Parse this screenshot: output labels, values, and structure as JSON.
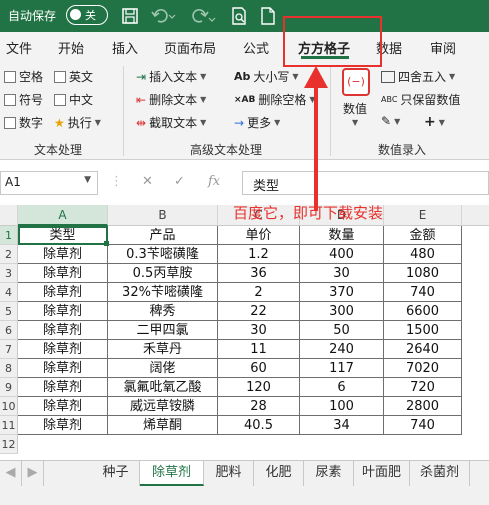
{
  "titlebar": {
    "autosave_label": "自动保存",
    "toggle_state": "关"
  },
  "tabs": [
    "文件",
    "开始",
    "插入",
    "页面布局",
    "公式",
    "方方格子",
    "数据",
    "审阅"
  ],
  "ribbon": {
    "text_group": {
      "items": [
        "空格",
        "英文",
        "符号",
        "中文",
        "数字",
        "执行"
      ],
      "title": "文本处理"
    },
    "advanced_group": {
      "items": [
        "插入文本",
        "删除文本",
        "截取文本",
        "大小写",
        "删除空格",
        "更多"
      ],
      "title": "高级文本处理"
    },
    "number_group": {
      "items": [
        "数值",
        "四舍五入",
        "只保留数值"
      ],
      "title": "数值录入",
      "abc_label": "ABC"
    }
  },
  "formula_bar": {
    "name_box": "A1",
    "fx": "fx",
    "formula": "类型"
  },
  "annotation": "百度它，即可下载安装",
  "sheet": {
    "columns": [
      "A",
      "B",
      "C",
      "D",
      "E"
    ],
    "rows": [
      [
        "类型",
        "产品",
        "单价",
        "数量",
        "金额"
      ],
      [
        "除草剂",
        "0.3苄嘧磺隆",
        "1.2",
        "400",
        "480"
      ],
      [
        "除草剂",
        "0.5丙草胺",
        "36",
        "30",
        "1080"
      ],
      [
        "除草剂",
        "32%苄嘧磺隆",
        "2",
        "370",
        "740"
      ],
      [
        "除草剂",
        "稗秀",
        "22",
        "300",
        "6600"
      ],
      [
        "除草剂",
        "二甲四氯",
        "30",
        "50",
        "1500"
      ],
      [
        "除草剂",
        "禾草丹",
        "11",
        "240",
        "2640"
      ],
      [
        "除草剂",
        "阔佬",
        "60",
        "117",
        "7020"
      ],
      [
        "除草剂",
        "氯氟吡氧乙酸",
        "120",
        "6",
        "720"
      ],
      [
        "除草剂",
        "威远草铵膦",
        "28",
        "100",
        "2800"
      ],
      [
        "除草剂",
        "烯草酮",
        "40.5",
        "34",
        "740"
      ]
    ]
  },
  "sheet_tabs": [
    "种子",
    "除草剂",
    "肥料",
    "化肥",
    "尿素",
    "叶面肥",
    "杀菌剂"
  ],
  "colors": {
    "excel_green": "#217346",
    "annotation_red": "#e8312c"
  }
}
